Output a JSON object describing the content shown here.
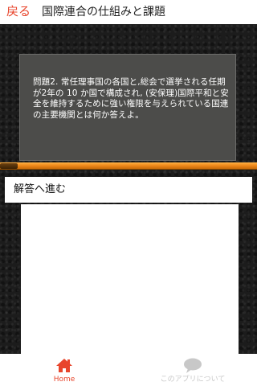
{
  "header": {
    "back_label": "戻る",
    "title": "国際連合の仕組みと課題"
  },
  "question": {
    "text": "問題2. 常任理事国の各国と,総会で選挙される任期が2年の 10 か国で構成され, (安保理)国際平和と安全を維持するために強い権限を与えられている国連の主要機関とは何か答えよ。"
  },
  "progress": {
    "fill_fraction": 1.0
  },
  "answer": {
    "label": "解答へ進む"
  },
  "bottom_nav": {
    "items": [
      {
        "label": "Home",
        "icon": "home-icon",
        "active": true
      },
      {
        "label": "このアプリについて",
        "icon": "speech-bubble-icon",
        "active": false
      }
    ]
  },
  "colors": {
    "accent": "#e8452c",
    "progress": "#f08a1c",
    "question_panel": "#4c4c4a",
    "inactive_nav": "#c8c8c8"
  }
}
